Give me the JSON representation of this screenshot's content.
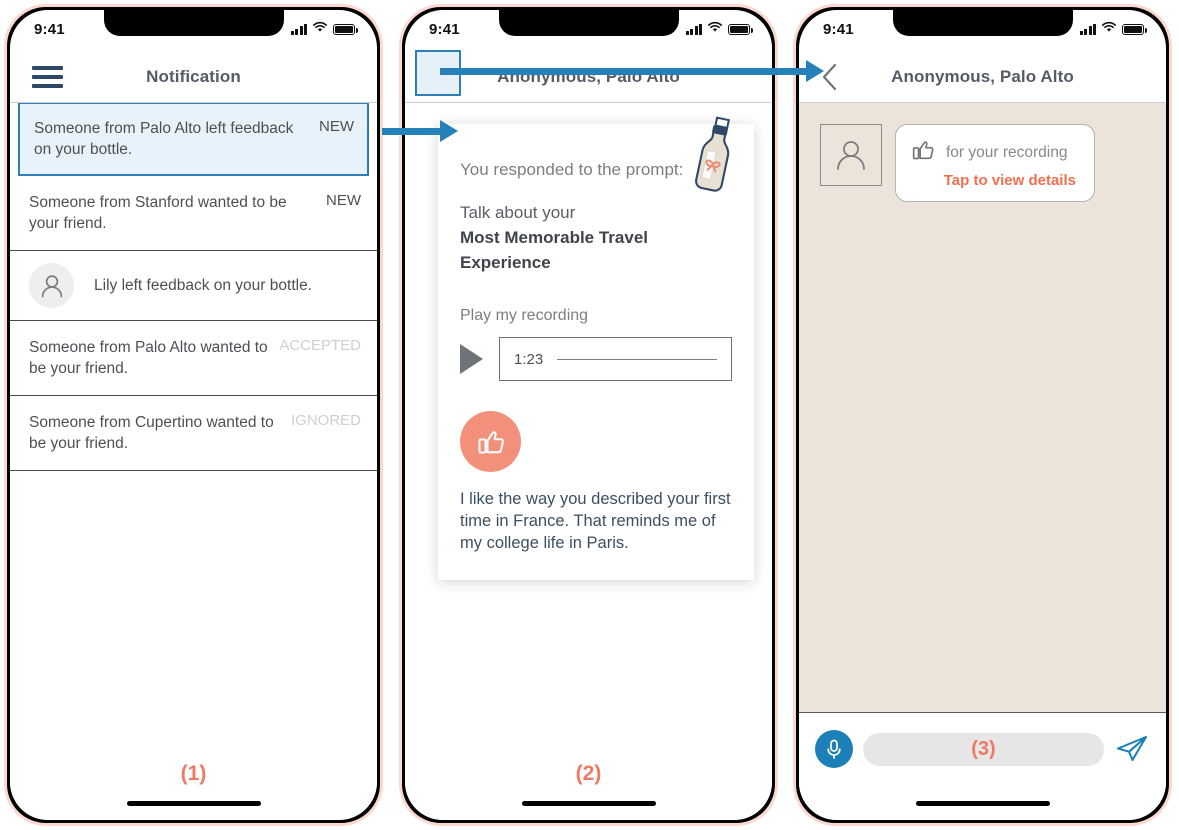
{
  "meta": {
    "accent_blue": "#2581b8",
    "accent_salmon": "#ef7a63",
    "chat_bg": "#ece4da",
    "highlight_bg": "#e8f2fa"
  },
  "status_bar": {
    "time": "9:41"
  },
  "screens": [
    {
      "step_label": "(1)",
      "nav": {
        "title": "Notification",
        "menu_icon": "hamburger-icon"
      },
      "notifications": [
        {
          "text": "Someone from Palo Alto left feedback on your bottle.",
          "tag": "NEW",
          "tag_state": "new",
          "avatar": false,
          "highlighted": true
        },
        {
          "text": "Someone from Stanford wanted to be your friend.",
          "tag": "NEW",
          "tag_state": "new",
          "avatar": false,
          "highlighted": false
        },
        {
          "text": "Lily left feedback on your bottle.",
          "tag": "",
          "tag_state": "none",
          "avatar": true,
          "highlighted": false
        },
        {
          "text": "Someone from Palo Alto wanted to be your friend.",
          "tag": "ACCEPTED",
          "tag_state": "muted",
          "avatar": false,
          "highlighted": false
        },
        {
          "text": "Someone from Cupertino wanted to be your friend.",
          "tag": "IGNORED",
          "tag_state": "muted",
          "avatar": false,
          "highlighted": false
        }
      ]
    },
    {
      "step_label": "(2)",
      "nav": {
        "title": "Anonymous, Palo Alto",
        "back_icon": "chevron-left-icon"
      },
      "card": {
        "prompt_lead": "You responded to the prompt:",
        "prompt_sub": "Talk about your",
        "prompt_strong": "Most Memorable Travel Experience",
        "play_label": "Play my recording",
        "duration": "1:23",
        "reaction_icon": "thumbs-up-icon",
        "feedback": "I like the way you described your first time in France. That reminds me of my college life in Paris.",
        "decoration_icon": "message-in-a-bottle-icon"
      }
    },
    {
      "step_label": "(3)",
      "nav": {
        "title": "Anonymous, Palo Alto",
        "back_icon": "chevron-left-icon"
      },
      "message": {
        "avatar_icon": "person-icon",
        "reaction_icon": "thumbs-up-icon",
        "text": "for your recording",
        "cta": "Tap to view details"
      },
      "input_bar": {
        "mic_icon": "microphone-icon",
        "placeholder": "(3)",
        "send_icon": "send-paper-plane-icon"
      }
    }
  ]
}
